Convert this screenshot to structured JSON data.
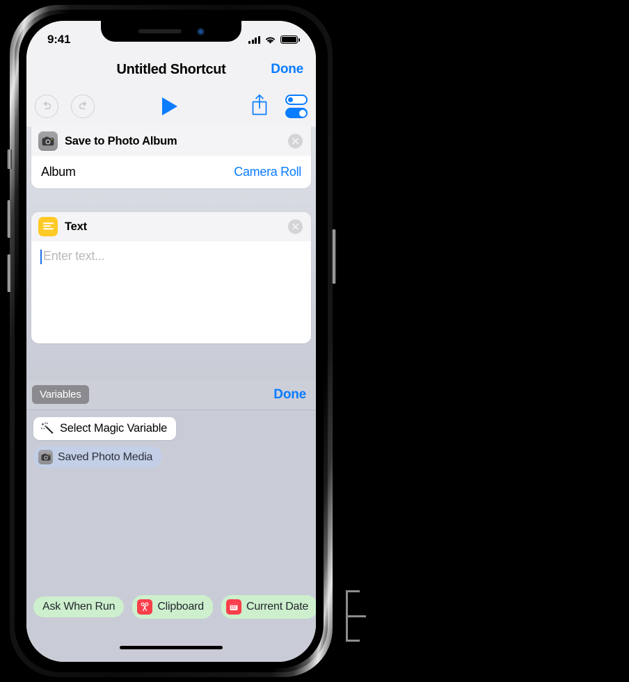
{
  "device": {
    "name": "iphone-x",
    "screen_bg": "#c9ccd6"
  },
  "status_bar": {
    "time": "9:41",
    "icons": [
      "cellular-signal-icon",
      "wifi-icon",
      "battery-icon"
    ]
  },
  "nav_bar": {
    "title": "Untitled Shortcut",
    "done_label": "Done",
    "accent_color": "#0a7cff"
  },
  "toolbar": {
    "undo_icon": "undo-arrow-icon",
    "redo_icon": "redo-arrow-icon",
    "play_icon": "play-triangle-icon",
    "share_icon": "share-up-arrow-icon",
    "settings_icon": "settings-toggles-icon"
  },
  "actions": [
    {
      "icon": "camera-icon",
      "icon_color": "#8e8e93",
      "title": "Save to Photo Album",
      "remove_icon": "close-circle-icon",
      "rows": [
        {
          "label": "Album",
          "value": "Camera Roll",
          "value_color": "#0a7cff"
        }
      ]
    },
    {
      "icon": "text-lines-icon",
      "icon_color": "#ffc927",
      "title": "Text",
      "remove_icon": "close-circle-icon",
      "text_field": {
        "value": "",
        "placeholder": "Enter text..."
      }
    }
  ],
  "variables_panel": {
    "toggle_label": "Variables",
    "done_label": "Done",
    "magic_variable": {
      "icon": "magic-wand-icon",
      "label": "Select Magic Variable"
    },
    "available": [
      {
        "icon": "camera-icon",
        "label": "Saved Photo Media",
        "pill_color": "#c3cfe6"
      }
    ]
  },
  "suggestion_chips": [
    {
      "label": "Ask When Run",
      "icon": null,
      "pill_color": "#cdefcd"
    },
    {
      "label": "Clipboard",
      "icon": "scissors-icon",
      "icon_color": "#fa3e4b",
      "pill_color": "#cdefcd"
    },
    {
      "label": "Current Date",
      "icon": "calendar-icon",
      "icon_color": "#fa3e4b",
      "pill_color": "#cdefcd"
    }
  ],
  "annotation": {
    "type": "callout-bracket",
    "color": "#8c8c8c"
  }
}
